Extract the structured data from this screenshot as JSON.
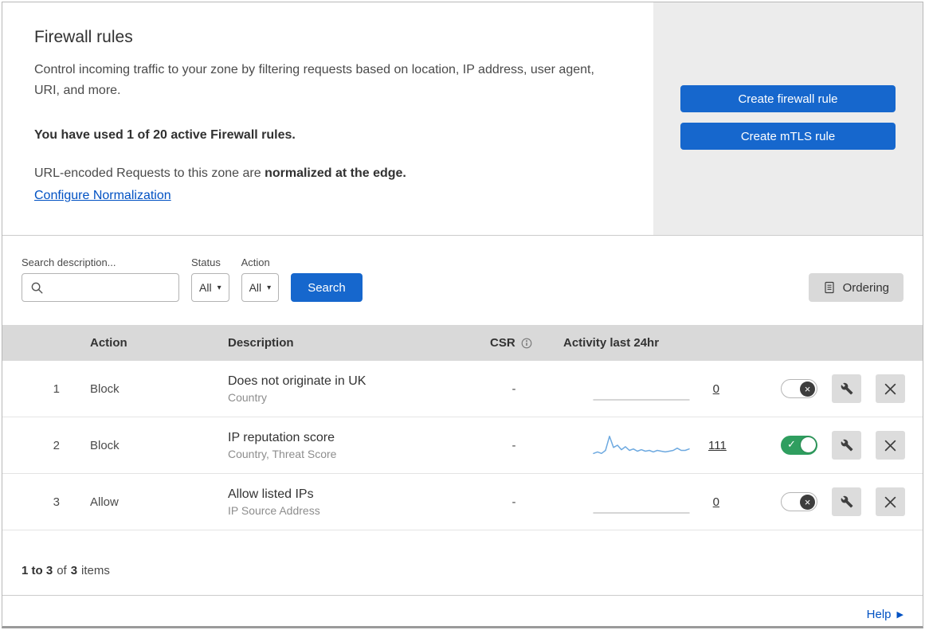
{
  "icons": {
    "chevron_down": "▾",
    "check": "✓",
    "close": "×",
    "help_arrow": "▶"
  },
  "colors": {
    "primary_blue": "#1667cd",
    "link_blue": "#0051c3",
    "toggle_green": "#2f9e5f"
  },
  "hero": {
    "title": "Firewall rules",
    "description": "Control incoming traffic to your zone by filtering requests based on location, IP address, user agent, URI, and more.",
    "usage": "You have used 1 of 20 active Firewall rules.",
    "normalization_prefix": "URL-encoded Requests to this zone are ",
    "normalization_bold": "normalized at the edge.",
    "normalization_link": "Configure Normalization",
    "create_firewall_button": "Create firewall rule",
    "create_mtls_button": "Create mTLS rule"
  },
  "filters": {
    "search_label": "Search description...",
    "status_label": "Status",
    "status_value": "All",
    "action_label": "Action",
    "action_value": "All",
    "search_button": "Search",
    "ordering_button": "Ordering"
  },
  "table": {
    "headers": {
      "action": "Action",
      "description": "Description",
      "csr": "CSR",
      "activity": "Activity last 24hr"
    },
    "rows": [
      {
        "index": "1",
        "action": "Block",
        "title": "Does not originate in UK",
        "subtitle": "Country",
        "csr": "-",
        "count": "0",
        "enabled": false,
        "sparkline": [
          0,
          0,
          0
        ],
        "spark_color": "#c9c9c9"
      },
      {
        "index": "2",
        "action": "Block",
        "title": "IP reputation score",
        "subtitle": "Country, Threat Score",
        "csr": "-",
        "count": "111",
        "enabled": true,
        "sparkline": [
          4,
          6,
          4,
          8,
          27,
          12,
          15,
          9,
          13,
          8,
          10,
          7,
          9,
          7,
          8,
          6,
          8,
          7,
          6,
          7,
          8,
          11,
          8,
          8,
          10
        ],
        "spark_color": "#6da9e0"
      },
      {
        "index": "3",
        "action": "Allow",
        "title": "Allow listed IPs",
        "subtitle": "IP Source Address",
        "csr": "-",
        "count": "0",
        "enabled": false,
        "sparkline": [
          0,
          0,
          0
        ],
        "spark_color": "#c9c9c9"
      }
    ],
    "footer": {
      "range": "1 to 3",
      "of_text": "of",
      "total": "3",
      "items_text": "items"
    }
  },
  "help": {
    "label": "Help"
  }
}
